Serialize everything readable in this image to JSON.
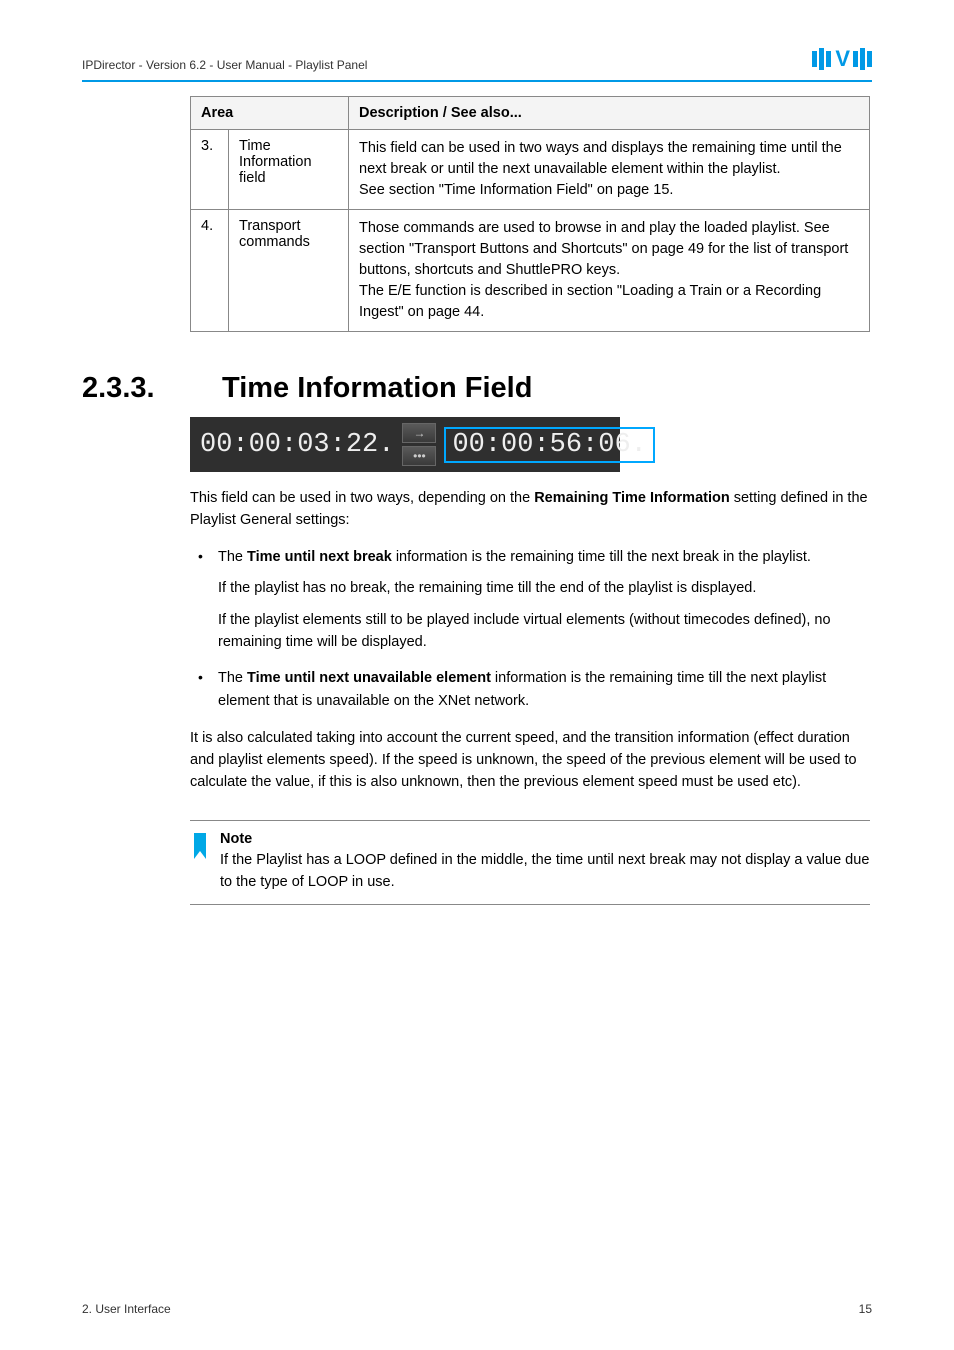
{
  "header": {
    "doc_title": "IPDirector - Version 6.2 - User Manual - Playlist Panel"
  },
  "table": {
    "head": {
      "area": "Area",
      "desc": "Description / See also..."
    },
    "rows": [
      {
        "num": "3.",
        "label": "Time Information field",
        "desc_1": "This field can be used in two ways and displays the remaining time until the next break or until the next unavailable element within the playlist.",
        "desc_2": "See section \"Time Information Field\" on page 15."
      },
      {
        "num": "4.",
        "label": "Transport commands",
        "desc_1": "Those commands are used to browse in and play the loaded playlist. See section \"Transport Buttons and Shortcuts\" on page 49 for the list of transport buttons, shortcuts and ShuttlePRO keys.",
        "desc_2": "The E/E function is described in section \"Loading a Train or a Recording Ingest\" on page 44."
      }
    ]
  },
  "section": {
    "number": "2.3.3.",
    "title": "Time Information Field"
  },
  "timecode": {
    "left": "00:00:03:22.",
    "right": "00:00:56:06.",
    "arrow": "→",
    "dots": "•••"
  },
  "body": {
    "intro_pre": "This field can be used in two ways, depending on the ",
    "intro_bold": "Remaining Time Information",
    "intro_post": " setting defined in the Playlist General settings:",
    "b1_pre": "The ",
    "b1_bold": "Time until next break",
    "b1_post": " information is the remaining time till the next break in the playlist.",
    "b1_sub1": "If the playlist has no break, the remaining time till the end of the playlist is displayed.",
    "b1_sub2": "If the playlist elements still to be played include virtual elements (without timecodes defined), no remaining time will be displayed.",
    "b2_pre": "The ",
    "b2_bold": "Time until next unavailable element",
    "b2_post": " information is the remaining time till the next playlist element that is unavailable on the XNet network.",
    "outro": "It is also calculated taking into account the current speed, and the transition information (effect duration and playlist elements speed). If the speed is unknown, the speed of the previous element will be used to calculate the value, if this is also unknown, then the previous element speed must be used etc)."
  },
  "note": {
    "label": "Note",
    "text": "If the Playlist has a LOOP defined in the middle, the time until next break may not display a value due to the type of LOOP in use."
  },
  "footer": {
    "left": "2. User Interface",
    "right": "15"
  }
}
